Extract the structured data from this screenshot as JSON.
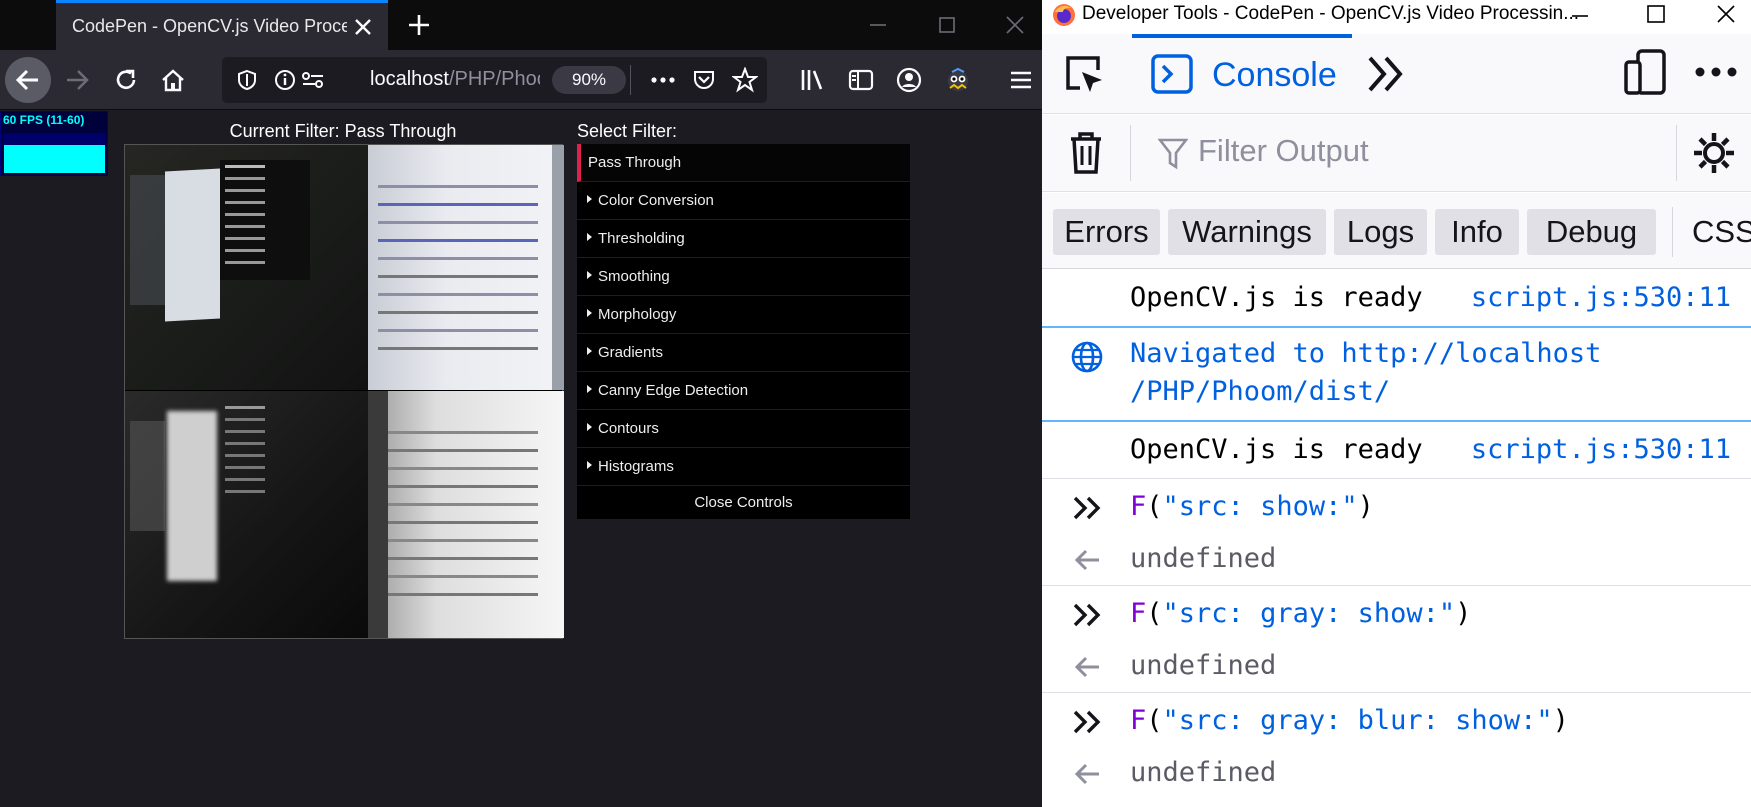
{
  "browser": {
    "tab_title": "CodePen - OpenCV.js Video Processing",
    "url_host": "localhost",
    "url_path": "/PHP/Phoom/dist/",
    "zoom": "90%"
  },
  "page": {
    "fps_label": "60 FPS (11-60)",
    "fps_level": 0.7,
    "current_filter_label": "Current Filter: Pass Through",
    "select_filter_label": "Select Filter:",
    "filters": [
      "Pass Through",
      "Color Conversion",
      "Thresholding",
      "Smoothing",
      "Morphology",
      "Gradients",
      "Canny Edge Detection",
      "Contours",
      "Histograms"
    ],
    "active_filter": "Pass Through",
    "close_controls": "Close Controls"
  },
  "devtools": {
    "window_title": "Developer Tools - CodePen - OpenCV.js Video Processin...",
    "console_tab": "Console",
    "filter_placeholder": "Filter Output",
    "levels": [
      "Errors",
      "Warnings",
      "Logs",
      "Info",
      "Debug"
    ],
    "css_label": "CSS",
    "messages": [
      {
        "type": "log",
        "text": "OpenCV.js is ready",
        "location": "script.js:530:11"
      },
      {
        "type": "nav",
        "line1": "Navigated to http://localhost",
        "line2": "/PHP/Phoom/dist/"
      },
      {
        "type": "log",
        "text": "OpenCV.js is ready",
        "location": "script.js:530:11"
      },
      {
        "type": "command",
        "fn": "F",
        "arg": "\"src: show:\""
      },
      {
        "type": "result",
        "text": "undefined"
      },
      {
        "type": "command",
        "fn": "F",
        "arg": "\"src: gray: show:\""
      },
      {
        "type": "result",
        "text": "undefined"
      },
      {
        "type": "command",
        "fn": "F",
        "arg": "\"src: gray: blur: show:\""
      },
      {
        "type": "result",
        "text": "undefined"
      }
    ]
  },
  "colors": {
    "accent_blue": "#0a84ff",
    "active_filter_border": "#e2204f",
    "fps_cyan": "#00ffff",
    "console_blue": "#0060df",
    "command_purple": "#8000d7"
  }
}
